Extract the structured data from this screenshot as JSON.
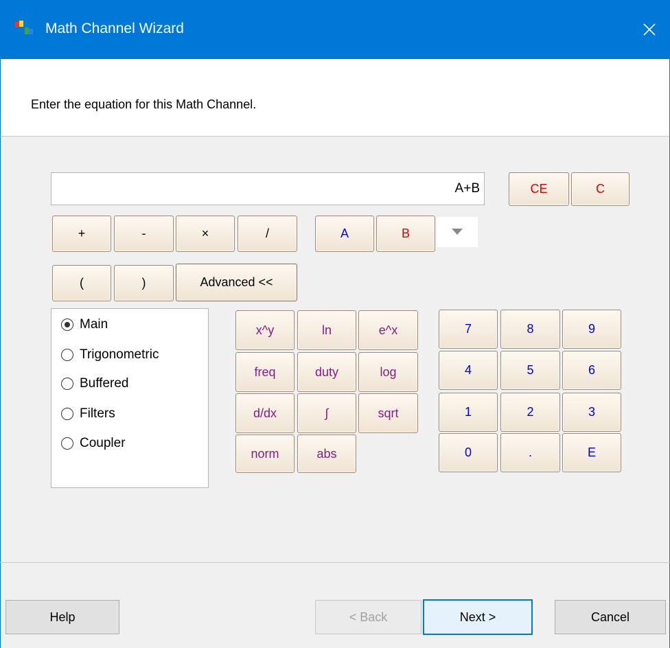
{
  "window": {
    "title": "Math Channel Wizard"
  },
  "header": {
    "instruction": "Enter the equation for this Math Channel."
  },
  "equation": {
    "value": "A+B"
  },
  "clear_buttons": {
    "ce": "CE",
    "c": "C"
  },
  "operators": {
    "plus": "+",
    "minus": "-",
    "times": "×",
    "divide": "/"
  },
  "channels": {
    "a": "A",
    "b": "B"
  },
  "parens": {
    "open": "(",
    "close": ")"
  },
  "advanced_label": "Advanced <<",
  "categories": [
    {
      "label": "Main",
      "checked": true
    },
    {
      "label": "Trigonometric",
      "checked": false
    },
    {
      "label": "Buffered",
      "checked": false
    },
    {
      "label": "Filters",
      "checked": false
    },
    {
      "label": "Coupler",
      "checked": false
    }
  ],
  "functions": {
    "pow": "x^y",
    "ln": "ln",
    "exp": "e^x",
    "freq": "freq",
    "duty": "duty",
    "log": "log",
    "ddx": "d/dx",
    "integral": "∫",
    "sqrt": "sqrt",
    "norm": "norm",
    "abs": "abs"
  },
  "keypad": {
    "k7": "7",
    "k8": "8",
    "k9": "9",
    "k4": "4",
    "k5": "5",
    "k6": "6",
    "k1": "1",
    "k2": "2",
    "k3": "3",
    "k0": "0",
    "dot": ".",
    "e": "E"
  },
  "footer": {
    "help": "Help",
    "back": "< Back",
    "next": "Next >",
    "cancel": "Cancel"
  },
  "colors": {
    "titlebar": "#0078d7",
    "red": "#e00000",
    "blue": "#0000ff",
    "purple": "#8a1a8a"
  }
}
